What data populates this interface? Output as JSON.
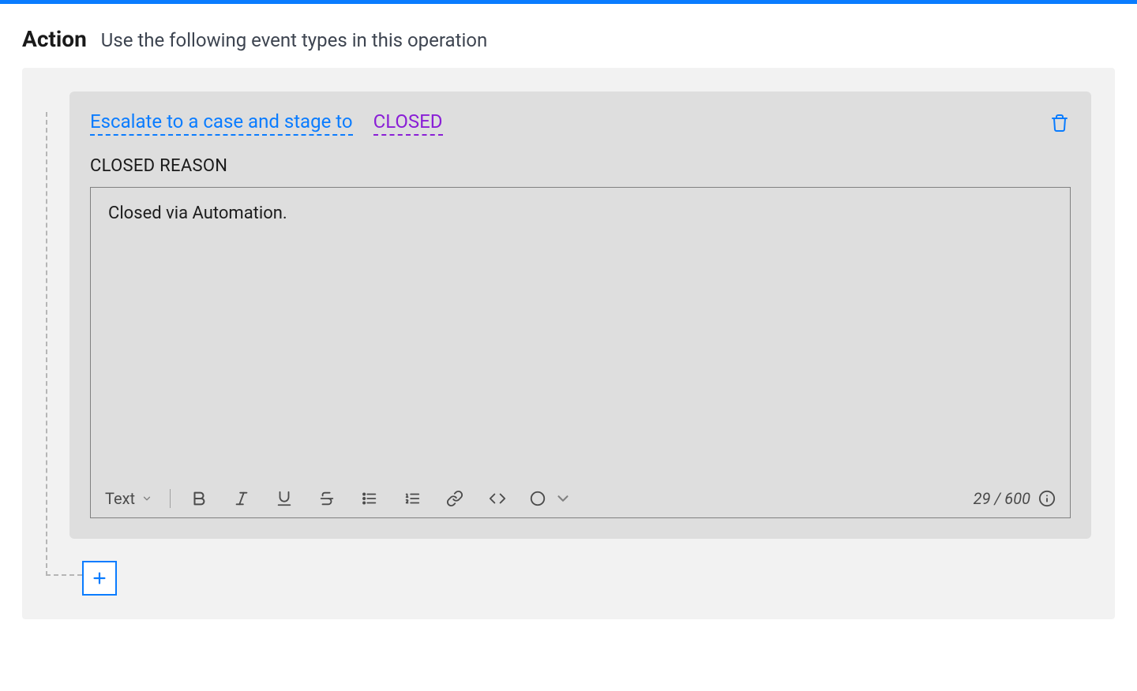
{
  "header": {
    "title": "Action",
    "subtitle": "Use the following event types in this operation"
  },
  "action": {
    "escalate_label": "Escalate to a case and stage to",
    "stage_value": "CLOSED",
    "reason_label": "CLOSED REASON",
    "reason_text": "Closed via Automation."
  },
  "editor": {
    "format_label": "Text",
    "char_counter": "29 / 600"
  },
  "icons": {
    "trash": "trash-icon",
    "bold": "bold-icon",
    "italic": "italic-icon",
    "underline": "underline-icon",
    "strike": "strikethrough-icon",
    "bullet_list": "bullet-list-icon",
    "number_list": "number-list-icon",
    "link": "link-icon",
    "code": "code-icon",
    "circle": "circle-icon",
    "chevron_down": "chevron-down-icon",
    "info": "info-icon",
    "plus": "plus-icon"
  }
}
